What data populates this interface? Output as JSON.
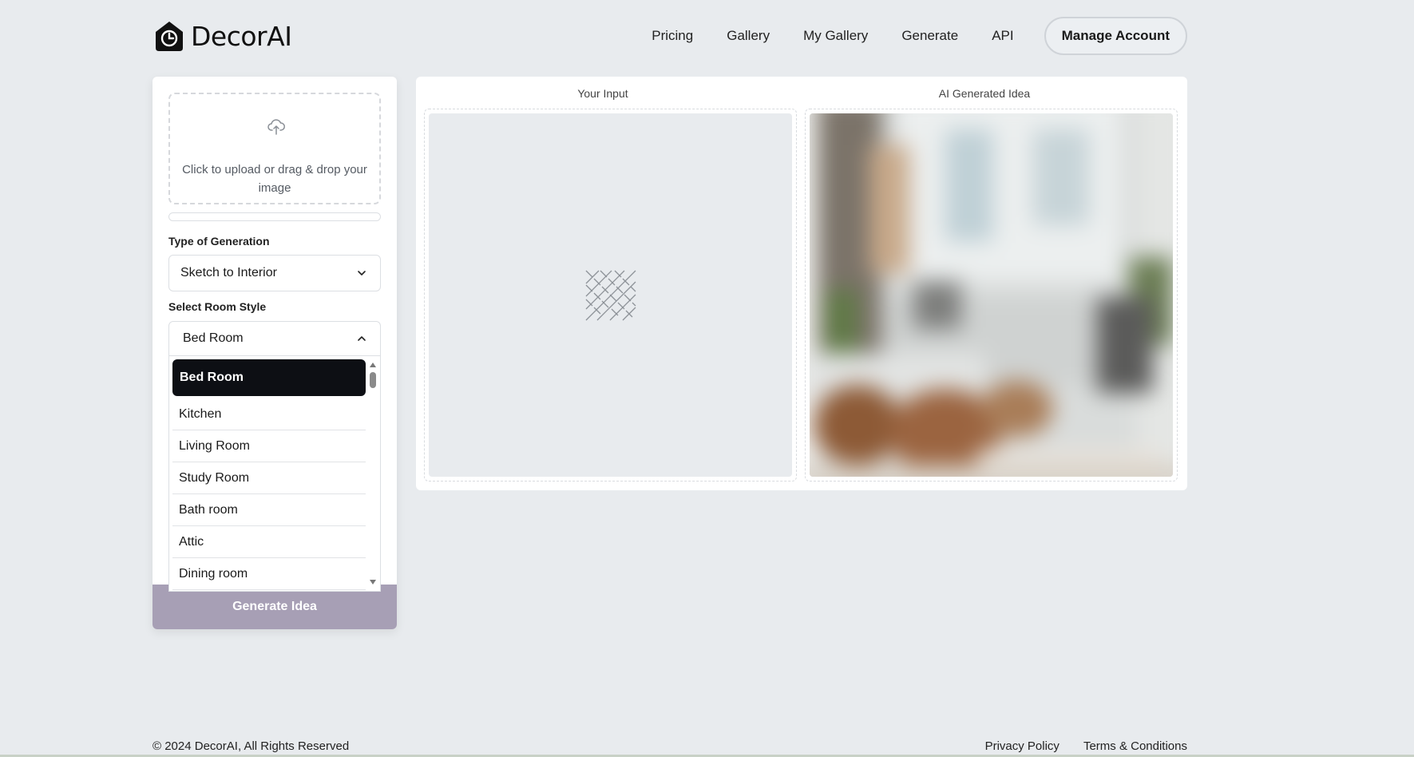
{
  "brand": {
    "name": "DecorAI"
  },
  "nav": {
    "links": [
      "Pricing",
      "Gallery",
      "My Gallery",
      "Generate",
      "API"
    ],
    "account_button": "Manage Account"
  },
  "upload": {
    "text": "Click to upload or drag & drop your image"
  },
  "generation_type": {
    "label": "Type of Generation",
    "value": "Sketch to Interior"
  },
  "room_style": {
    "label": "Select Room Style",
    "value": "Bed Room",
    "options": [
      "Bed Room",
      "Kitchen",
      "Living Room",
      "Study Room",
      "Bath room",
      "Attic",
      "Dining room"
    ]
  },
  "generate_button": "Generate Idea",
  "preview": {
    "input_title": "Your Input",
    "ai_title": "AI Generated Idea"
  },
  "footer": {
    "copyright": "© 2024 DecorAI, All Rights Reserved",
    "links": [
      "Privacy Policy",
      "Terms & Conditions"
    ]
  },
  "colors": {
    "background": "#e8ebee",
    "selected_option": "#0d0f14",
    "generate_button": "#a79fb5"
  }
}
